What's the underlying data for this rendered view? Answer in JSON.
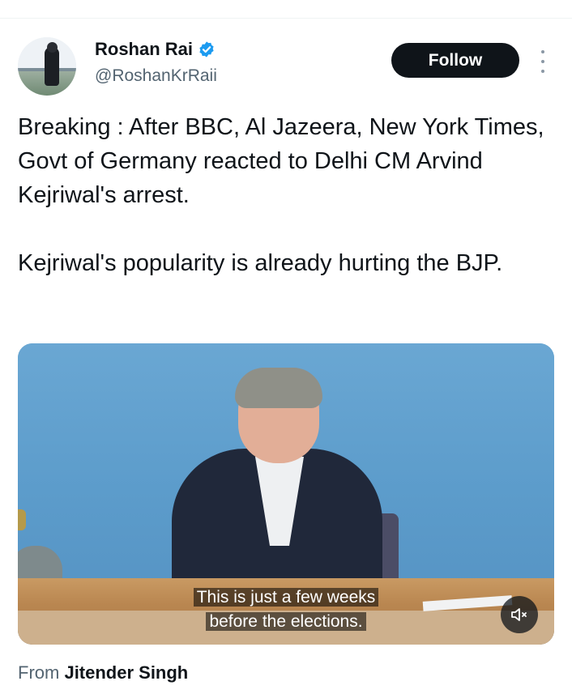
{
  "author": {
    "name": "Roshan Rai",
    "handle": "@RoshanKrRaii",
    "verified_icon": "verified-badge-icon",
    "verified_color": "#1d9bf0"
  },
  "actions": {
    "follow_label": "Follow",
    "more_icon": "more-vertical-icon"
  },
  "tweet": {
    "text": "Breaking : After BBC, Al Jazeera, New York Times, Govt of Germany reacted to Delhi CM Arvind Kejriwal's arrest.\n\nKejriwal's popularity is already hurting the BJP."
  },
  "media": {
    "subtitle_line1": "This is just a few weeks",
    "subtitle_line2": "before the elections.",
    "mute_icon": "volume-muted-icon"
  },
  "source": {
    "prefix": "From",
    "name": "Jitender Singh"
  },
  "colors": {
    "text_primary": "#0f1419",
    "text_secondary": "#536471",
    "button_bg": "#0f1419",
    "button_text": "#ffffff"
  }
}
